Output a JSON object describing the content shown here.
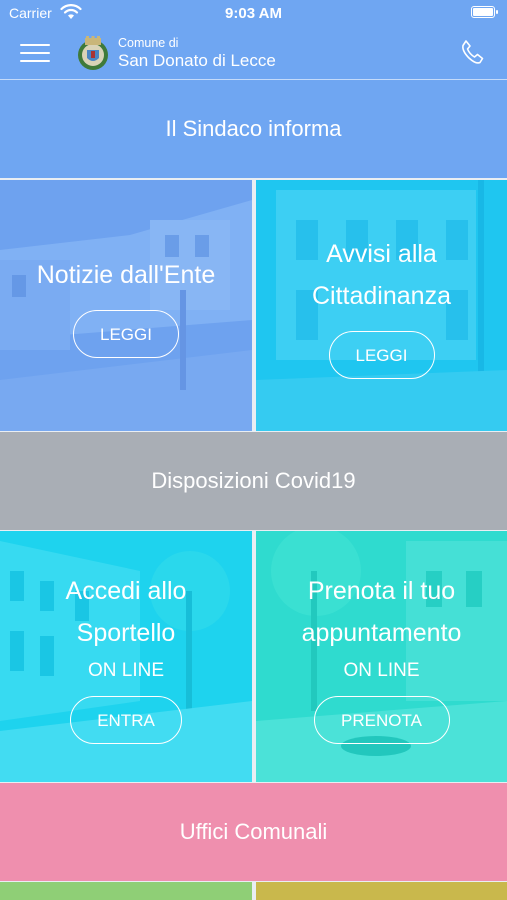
{
  "status_bar": {
    "carrier": "Carrier",
    "time": "9:03 AM"
  },
  "nav": {
    "comune_label": "Comune di",
    "comune_name": "San Donato di Lecce"
  },
  "rows": {
    "sindaco": "Il Sindaco informa",
    "covid": "Disposizioni Covid19",
    "uffici": "Uffici Comunali"
  },
  "tiles": {
    "notizie": {
      "title": "Notizie dall'Ente",
      "button": "LEGGI"
    },
    "avvisi": {
      "title_line1": "Avvisi alla",
      "title_line2": "Cittadinanza",
      "button": "LEGGI"
    },
    "accedi": {
      "title_line1": "Accedi allo",
      "title_line2": "Sportello",
      "subtitle": "ON LINE",
      "button": "ENTRA"
    },
    "prenota": {
      "title_line1": "Prenota il tuo",
      "title_line2": "appuntamento",
      "subtitle": "ON LINE",
      "button": "PRENOTA"
    }
  },
  "colors": {
    "header_blue": "#6fa6f2",
    "tile_cyan": "#1fd6f0",
    "tile_teal": "#34dfd2",
    "covid_gray": "#a9aeb5",
    "uffici_pink": "#ef8fae"
  },
  "icons": [
    "wifi-icon",
    "battery-icon",
    "menu-icon",
    "crest-icon",
    "phone-icon"
  ]
}
